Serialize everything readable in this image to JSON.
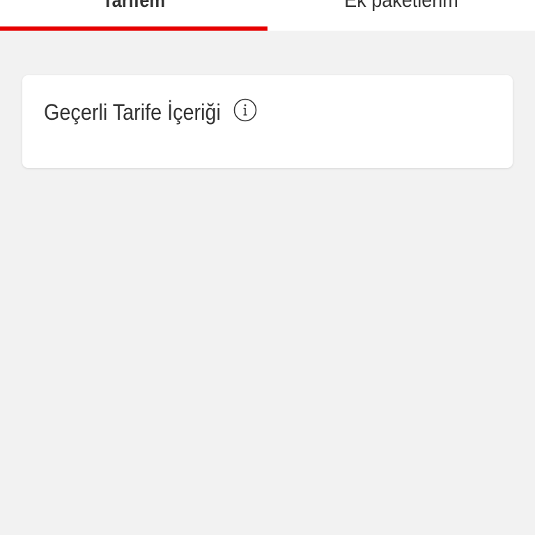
{
  "tabs": [
    {
      "label": "Tarifem",
      "active": true
    },
    {
      "label": "Ek paketlerim",
      "active": false
    }
  ],
  "card": {
    "title": "Geçerli Tarife İçeriği",
    "info_icon": "info-icon"
  },
  "colors": {
    "accent": "#e60000",
    "background": "#f2f2f2",
    "card": "#ffffff",
    "text": "#333333"
  }
}
